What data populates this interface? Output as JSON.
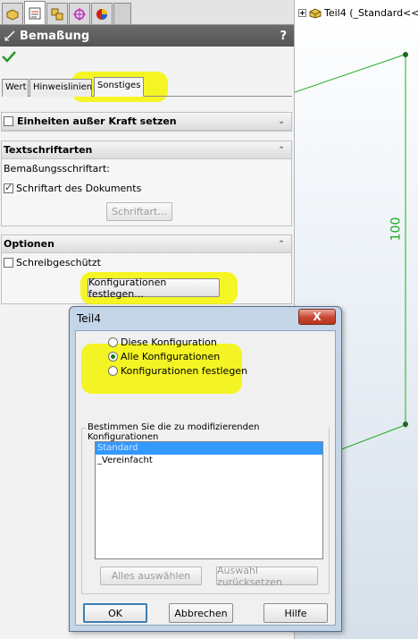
{
  "graphics": {
    "tree_item": "Teil4  (_Standard<<",
    "dimension_value": "100",
    "dimension_color": "#22aa22"
  },
  "panel": {
    "title": "Bemaßung",
    "help": "?",
    "tabs": [
      "Wert",
      "Hinweislinien",
      "Sonstiges"
    ],
    "group_units": {
      "label": "Einheiten außer Kraft setzen"
    },
    "group_font": {
      "title": "Textschriftarten",
      "dim_font_label": "Bemaßungsschriftart:",
      "doc_font_label": "Schriftart des Dokuments",
      "font_button": "Schriftart..."
    },
    "group_options": {
      "title": "Optionen",
      "readonly_label": "Schreibgeschützt",
      "config_button": "Konfigurationen festlegen..."
    }
  },
  "dialog": {
    "title": "Teil4",
    "close": "X",
    "radios": [
      "Diese Konfiguration",
      "Alle Konfigurationen",
      "Konfigurationen festlegen"
    ],
    "selected_radio": "Alle Konfigurationen",
    "legend": "Bestimmen Sie die zu modifizierenden Konfigurationen",
    "list_items": [
      "Standard",
      "_Vereinfacht"
    ],
    "select_all": "Alles auswählen",
    "reset": "Auswahl zurücksetzen",
    "ok": "OK",
    "cancel": "Abbrechen",
    "help": "Hilfe"
  },
  "colors": {
    "highlight": "#f4f400",
    "header": "#5e5e5e",
    "radio_selected": "#1b7a1b",
    "list_selection": "#3399ff"
  }
}
